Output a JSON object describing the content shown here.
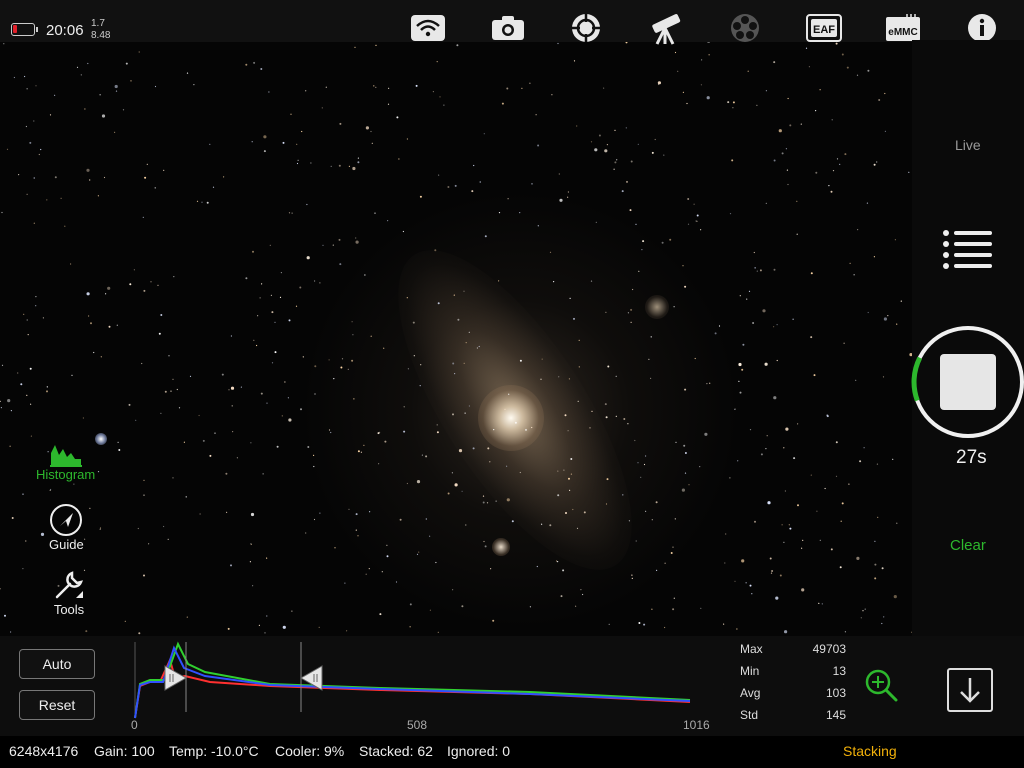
{
  "top_bar": {
    "clock": "20:06",
    "version_top": "1.7",
    "version_bottom": "8.48",
    "icons": [
      "wifi-icon",
      "camera-icon",
      "target-icon",
      "telescope-icon",
      "filter-wheel-icon",
      "eaf-icon",
      "emmc-icon",
      "info-icon"
    ],
    "eaf_label": "EAF",
    "emmc_label": "eMMC",
    "battery_color": "#e0202a"
  },
  "right_panel": {
    "live_label": "Live",
    "timer": "27s",
    "clear_label": "Clear",
    "progress_fraction": 0.13,
    "accent": "#2db82d"
  },
  "left_tools": {
    "histogram_label": "Histogram",
    "guide_label": "Guide",
    "tools_label": "Tools"
  },
  "bottom": {
    "auto_label": "Auto",
    "reset_label": "Reset",
    "axis_labels": [
      "0",
      "508",
      "1016"
    ],
    "stats": [
      {
        "label": "Max",
        "value": "49703"
      },
      {
        "label": "Min",
        "value": "13"
      },
      {
        "label": "Avg",
        "value": "103"
      },
      {
        "label": "Std",
        "value": "145"
      }
    ]
  },
  "status_bar": {
    "resolution": "6248x4176",
    "gain": "Gain: 100",
    "temp": "Temp: -10.0°C",
    "cooler": "Cooler: 9%",
    "stacked": "Stacked: 62",
    "ignored": "Ignored: 0",
    "state": "Stacking",
    "state_color": "#f2b10a"
  }
}
